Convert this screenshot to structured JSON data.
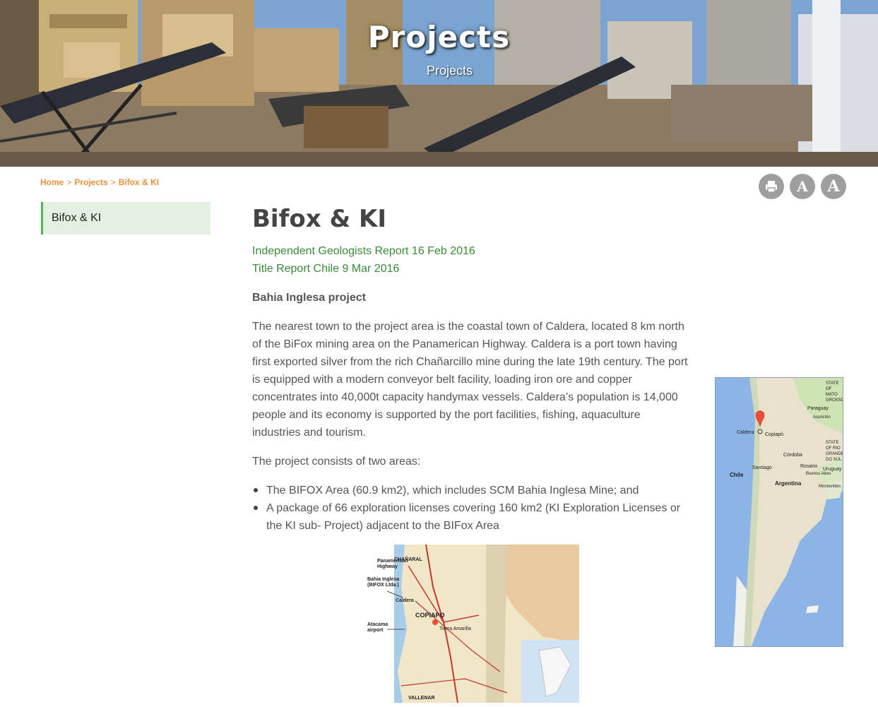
{
  "hero": {
    "title": "Projects",
    "subtitle": "Projects"
  },
  "breadcrumb": {
    "items": [
      "Home",
      "Projects",
      "Bifox & KI"
    ],
    "separator": ">"
  },
  "tools": {
    "print_icon": "print-icon",
    "font_small_label": "A",
    "font_large_label": "A"
  },
  "sidebar": {
    "items": [
      {
        "label": "Bifox & KI",
        "active": true
      }
    ]
  },
  "main": {
    "title": "Bifox & KI",
    "links": [
      "Independent Geologists Report 16 Feb 2016",
      "Title Report Chile 9 Mar 2016"
    ],
    "subheading": "Bahia Inglesa project",
    "paragraph_1": "The nearest town to the project area is the coastal town of Caldera, located 8 km north of the BiFox mining area on the Panamerican Highway. Caldera is a port town having first exported silver from the rich Chañarcillo mine during the late 19th century. The port is equipped with a modern conveyor belt facility, loading iron ore and copper concentrates into 40,000t capacity handymax vessels. Caldera’s population is 14,000 people and its economy is supported by the port facilities, fishing, aquaculture industries and tourism.",
    "paragraph_2": "The project consists of two areas:",
    "bullets": [
      "The BIFOX Area (60.9 km2), which includes SCM Bahia Inglesa Mine; and",
      "A package of 66 exploration licenses covering 160 km2 (KI Exploration Licenses or the KI sub- Project) adjacent to the BIFox Area"
    ]
  },
  "region_map": {
    "labels": [
      "CHAÑARAL",
      "Panamerican Highway",
      "Bahia Inglesa (BIFOX Ltda.)",
      "Caldera",
      "COPIAPO",
      "Tierra Amarilla",
      "Atacama airport",
      "VALLENAR"
    ]
  },
  "chile_map": {
    "labels": [
      "Paraguay",
      "Asunción",
      "Caldera",
      "Copiapó",
      "Córdoba",
      "Rosario",
      "Uruguay",
      "Santiago",
      "Chile",
      "Argentina",
      "Buenos Aires",
      "Montevideo",
      "STATE OF MATO GROSSO",
      "STATE OF RIO GRANDE DO SUL"
    ]
  },
  "colors": {
    "accent_orange": "#e8913a",
    "link_green": "#3a8a3a",
    "sidebar_active_bg": "#e1f0e1",
    "sidebar_active_border": "#5cae5c",
    "tool_button_bg": "#9e9e9e"
  }
}
